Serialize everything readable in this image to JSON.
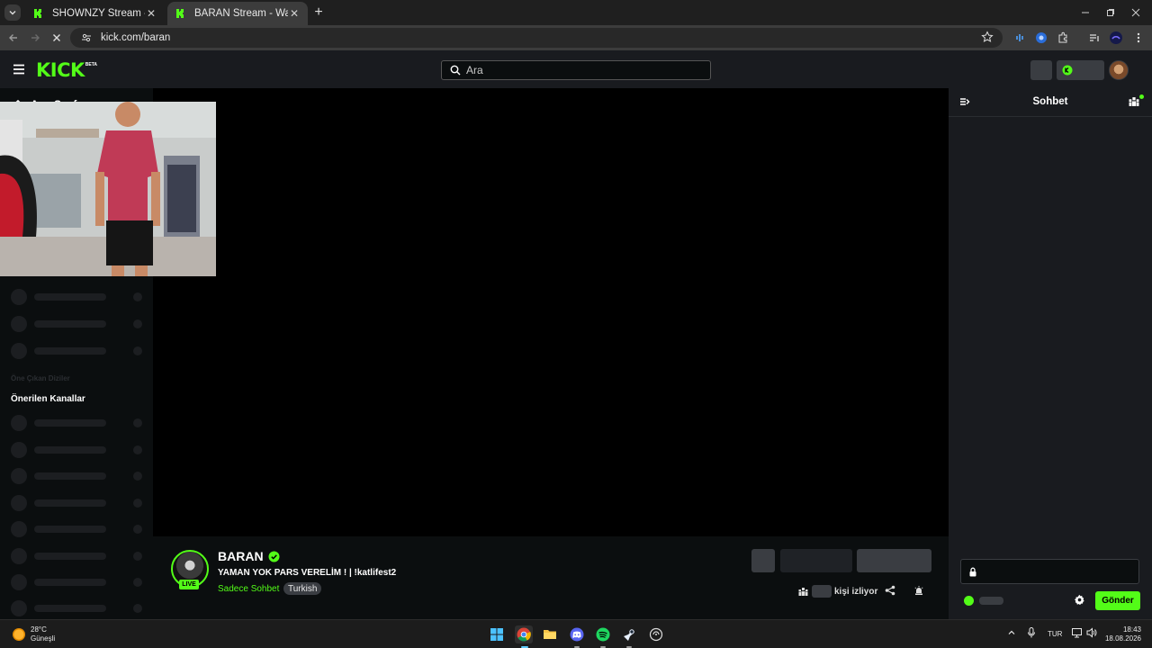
{
  "browser": {
    "tabs": [
      {
        "title": "SHOWNZY Stream - Watch Live",
        "active": false
      },
      {
        "title": "BARAN Stream - Watch Live on",
        "active": true
      }
    ],
    "url": "kick.com/baran"
  },
  "topnav": {
    "logo": "KICK",
    "logo_tag": "BETA",
    "search_placeholder": "Ara"
  },
  "sidebar": {
    "home_label": "Ana Sayfa",
    "faded_heading": "Öne Çıkan Diziler",
    "recommended_heading": "Önerilen Kanallar"
  },
  "channel": {
    "name": "BARAN",
    "live_badge": "LIVE",
    "stream_title": "YAMAN YOK PARS VERELİM ! | !katlifest2",
    "category": "Sadece Sohbet",
    "language": "Turkish",
    "viewers_suffix": "kişi izliyor"
  },
  "chat": {
    "title": "Sohbet",
    "send_label": "Gönder"
  },
  "taskbar": {
    "temperature": "28°C",
    "weather": "Güneşli",
    "language": "TUR",
    "time": "18:43",
    "date": "18.08.2026"
  },
  "colors": {
    "kick_green": "#53fc18",
    "bg": "#0b0e0f",
    "panel": "#191b1f",
    "skeleton": "#3a3d42"
  }
}
